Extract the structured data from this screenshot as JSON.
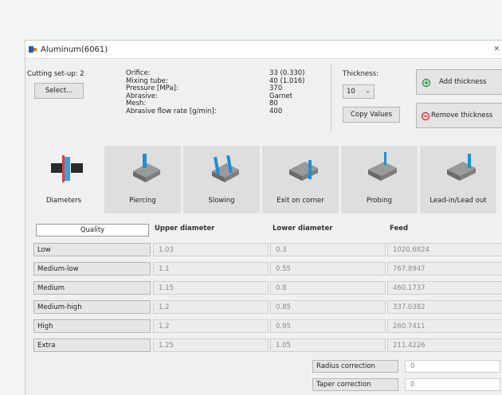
{
  "window": {
    "title": "Aluminum(6061)",
    "close_glyph": "✕"
  },
  "cutting": {
    "label": "Cutting set-up: 2",
    "select_label": "Select..."
  },
  "params": {
    "labels": [
      "Orifice:",
      "Mixing tube:",
      "Pressure [MPa]:",
      "Abrasive:",
      "Mesh:",
      "Abrasive flow rate [g/min]:"
    ],
    "values": [
      "33 (0.330)",
      "40 (1.016)",
      "370",
      "Garnet",
      "80",
      "400"
    ]
  },
  "thickness": {
    "label": "Thickness:",
    "value": "10",
    "copy_label": "Copy Values"
  },
  "actions": {
    "add_label": "Add thickness",
    "remove_label": "Remove thickness"
  },
  "operations": [
    {
      "label": "Diameters",
      "icon": "diameters-icon"
    },
    {
      "label": "Piercing",
      "icon": "piercing-icon"
    },
    {
      "label": "Slowing",
      "icon": "slowing-icon"
    },
    {
      "label": "Exit on corner",
      "icon": "exit-corner-icon"
    },
    {
      "label": "Probing",
      "icon": "probing-icon"
    },
    {
      "label": "Lead-in/Lead out",
      "icon": "lead-in-icon"
    }
  ],
  "table": {
    "headers": {
      "quality": "Quality",
      "upper": "Upper diameter",
      "lower": "Lower diameter",
      "feed": "Feed"
    },
    "rows": [
      {
        "quality": "Low",
        "upper": "1.03",
        "lower": "0.3",
        "feed": "1020.6824"
      },
      {
        "quality": "Medium-low",
        "upper": "1.1",
        "lower": "0.55",
        "feed": "767.8947"
      },
      {
        "quality": "Medium",
        "upper": "1.15",
        "lower": "0.8",
        "feed": "460.1737"
      },
      {
        "quality": "Medium-high",
        "upper": "1.2",
        "lower": "0.85",
        "feed": "337.0382"
      },
      {
        "quality": "High",
        "upper": "1.2",
        "lower": "0.95",
        "feed": "260.7411"
      },
      {
        "quality": "Extra",
        "upper": "1.25",
        "lower": "1.05",
        "feed": "211.4226"
      }
    ]
  },
  "corrections": [
    {
      "label": "Radius correction",
      "value": "0"
    },
    {
      "label": "Taper correction",
      "value": "0"
    }
  ],
  "colors": {
    "accent_blue": "#1f8fd6",
    "active_red": "#e04040",
    "add_green": "#2a9d3a"
  }
}
